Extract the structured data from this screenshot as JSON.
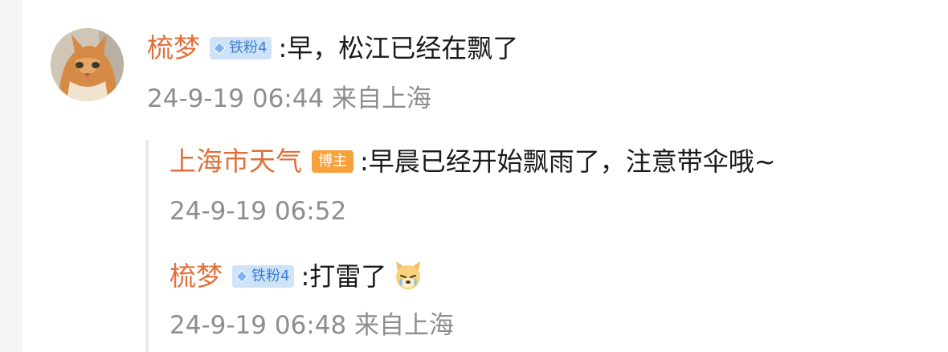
{
  "comment": {
    "username": "梳梦",
    "badge": "铁粉4",
    "text": ":早，松江已经在飘了",
    "meta": "24-9-19 06:44 来自上海"
  },
  "replies": [
    {
      "username": "上海市天气",
      "badge": "博主",
      "text": ":早晨已经开始飘雨了，注意带伞哦~",
      "meta": "24-9-19 06:52"
    },
    {
      "username": "梳梦",
      "badge": "铁粉4",
      "text": ":打雷了",
      "meta": "24-9-19 06:48 来自上海"
    }
  ],
  "colors": {
    "username": "#e0703a",
    "meta": "#8e8e8e",
    "fan_badge_bg": "#cfe3f8",
    "host_badge_bg": "#f7a13a"
  },
  "icons": {
    "fan_badge": "diamond-gem-icon",
    "emoji": "crying-dog-emoji-icon"
  }
}
